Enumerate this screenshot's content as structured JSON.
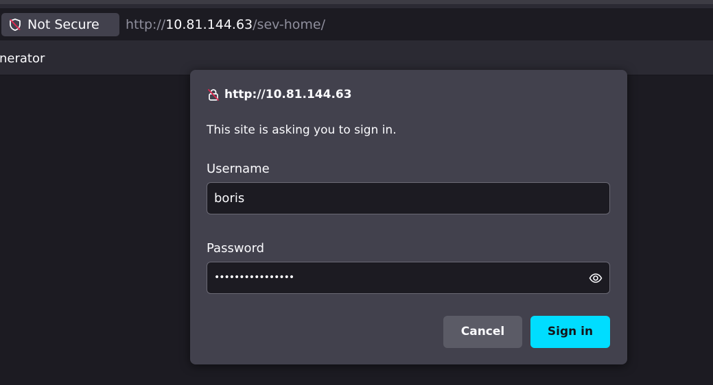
{
  "browser": {
    "identity_label": "Not Secure",
    "url": {
      "scheme": "http://",
      "host": "10.81.144.63",
      "path": "/sev-home/"
    },
    "bookmarks": [
      "nerator"
    ]
  },
  "auth_dialog": {
    "origin": "http://10.81.144.63",
    "message": "This site is asking you to sign in.",
    "username_label": "Username",
    "username_value": "boris",
    "password_label": "Password",
    "password_mask": "••••••••••••••••",
    "cancel_label": "Cancel",
    "signin_label": "Sign in"
  },
  "colors": {
    "accent": "#00ddff",
    "background": "#1c1b22",
    "dialog": "#42414d",
    "not_secure_red": "#e22850"
  },
  "icons": {
    "identity": "shield-slash-icon",
    "dialog_title": "lock-slash-icon",
    "reveal_password": "eye-icon"
  }
}
